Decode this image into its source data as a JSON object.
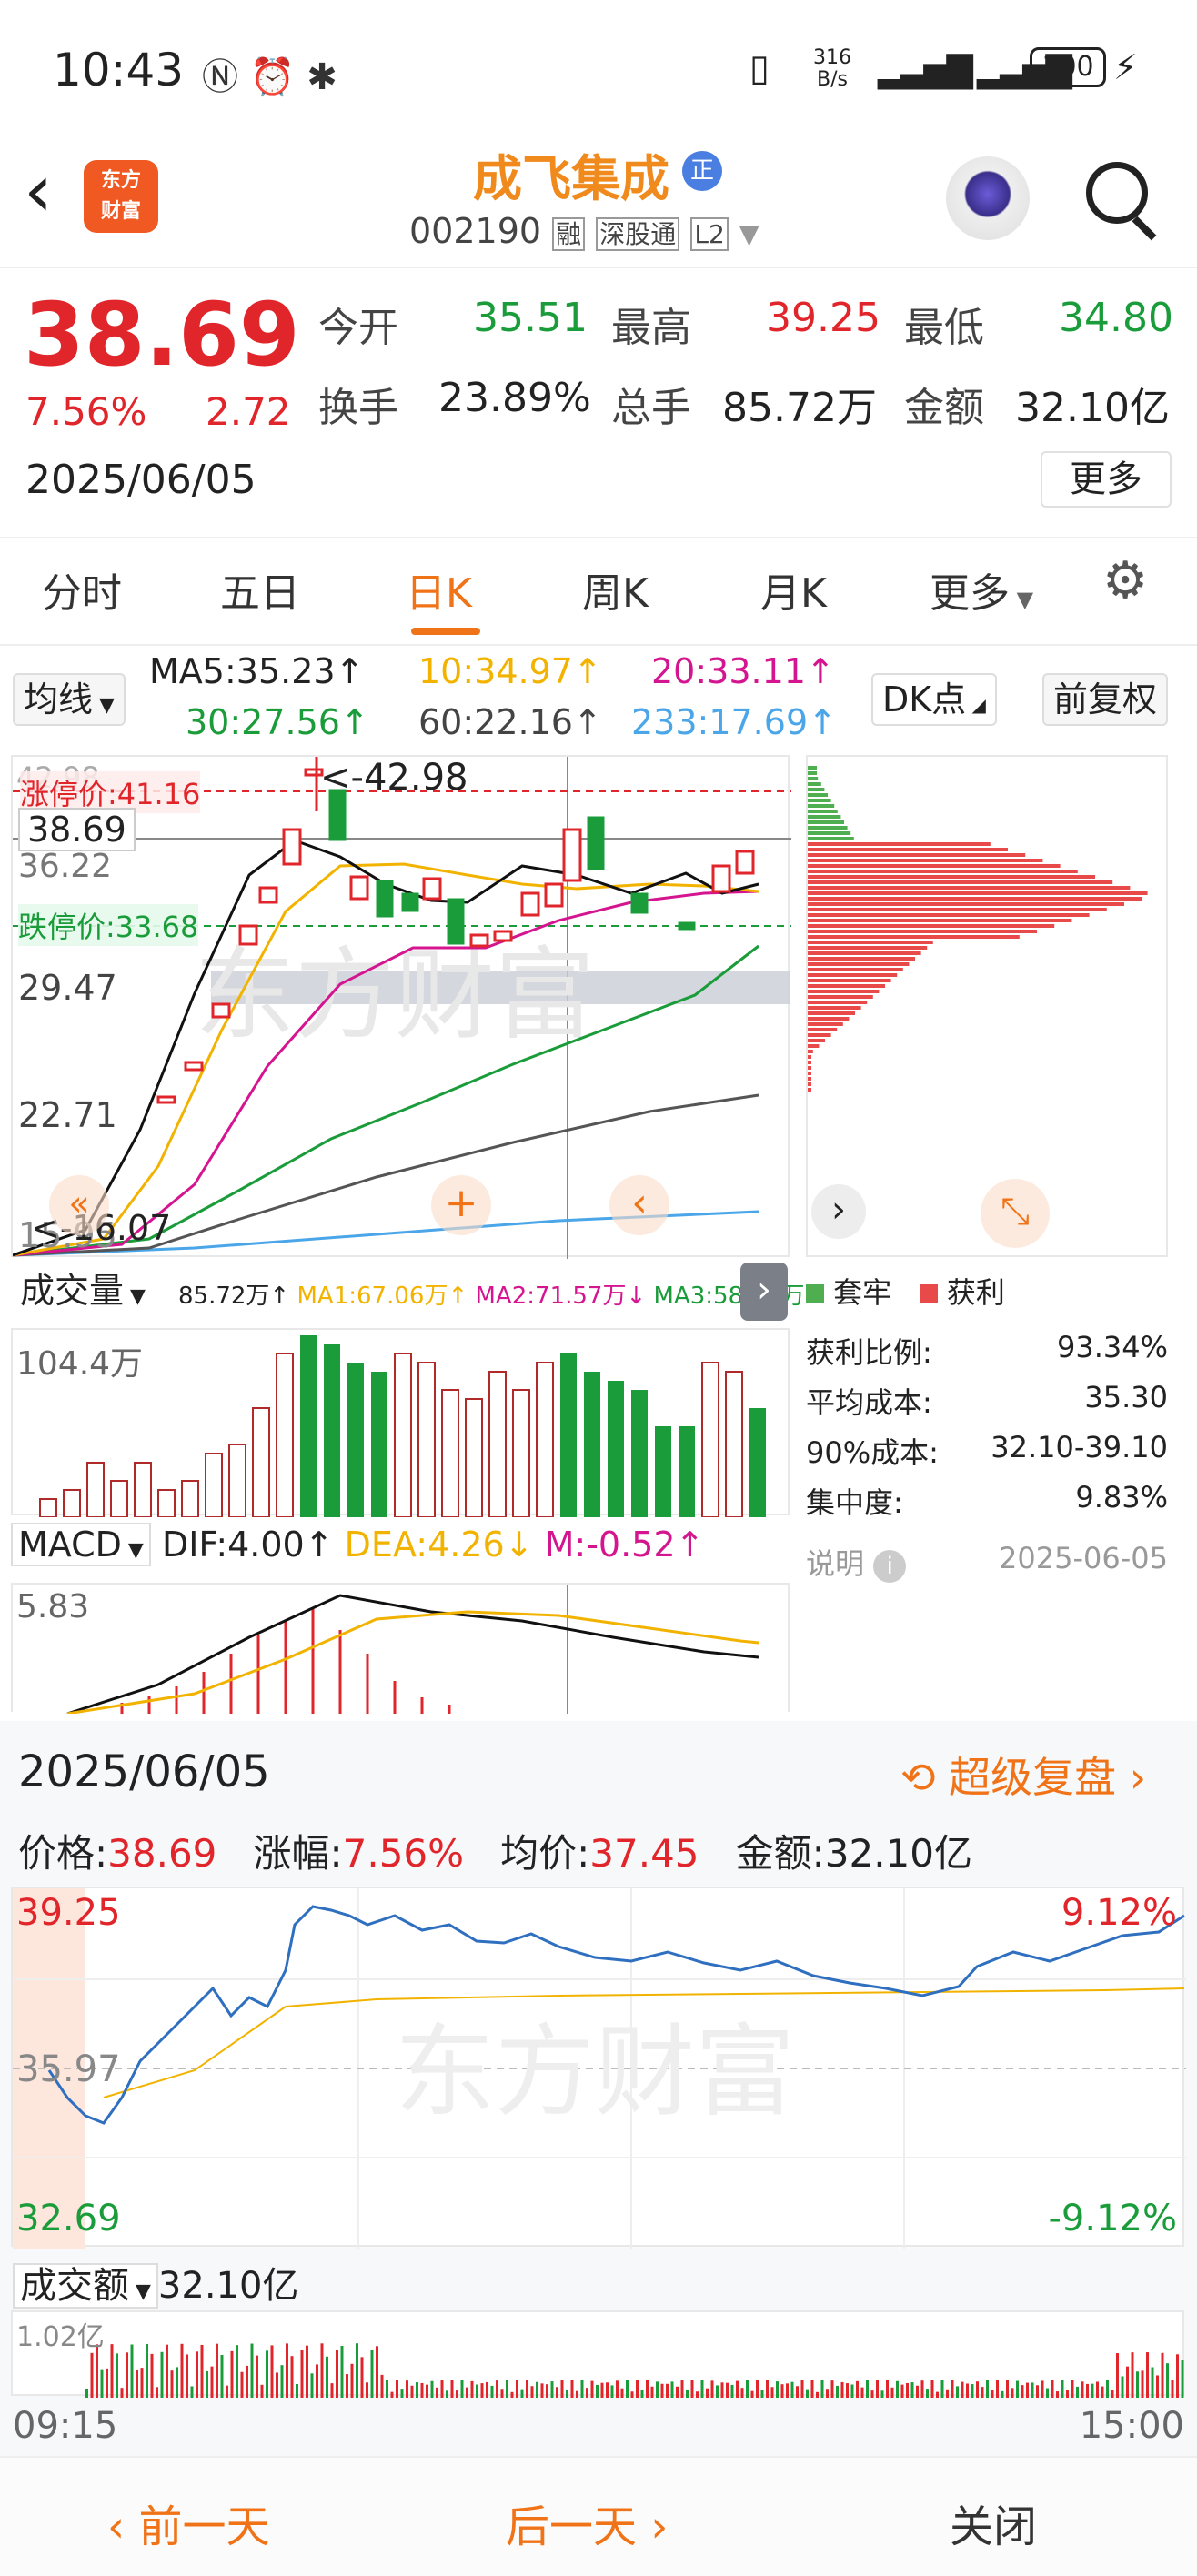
{
  "status": {
    "time": "10:43",
    "net": "316",
    "net_unit": "B/s",
    "battery": "100"
  },
  "header": {
    "stock_name": "成飞集成",
    "badge": "正",
    "code": "002190",
    "tags": [
      "融",
      "深股通",
      "L2"
    ],
    "logo_line1": "东方",
    "logo_line2": "财富"
  },
  "quote": {
    "price": "38.69",
    "pct": "7.56%",
    "change": "2.72",
    "date": "2025/06/05",
    "more": "更多",
    "stats": [
      {
        "label": "今开",
        "value": "35.51"
      },
      {
        "label": "最高",
        "value": "39.25"
      },
      {
        "label": "最低",
        "value": "34.80"
      },
      {
        "label": "换手",
        "value": "23.89%"
      },
      {
        "label": "总手",
        "value": "85.72万"
      },
      {
        "label": "金额",
        "value": "32.10亿"
      }
    ]
  },
  "tabs": [
    "分时",
    "五日",
    "日K",
    "周K",
    "月K",
    "更多"
  ],
  "kchart": {
    "ma_select": "均线",
    "dk": "DK点",
    "fq": "前复权",
    "ma": [
      {
        "t": "MA5:35.23↑",
        "c": "#222"
      },
      {
        "t": "10:34.97↑",
        "c": "#f2b300"
      },
      {
        "t": "20:33.11↑",
        "c": "#d4158f"
      },
      {
        "t": "30:27.56↑",
        "c": "#1a9c3a"
      },
      {
        "t": "60:22.16↑",
        "c": "#444"
      },
      {
        "t": "233:17.69↑",
        "c": "#4aa6e8"
      }
    ],
    "yticks": [
      "42.98",
      "36.22",
      "29.47",
      "22.71",
      "15.95"
    ],
    "limit_up": "涨停价:41.16",
    "limit_down": "跌停价:33.68",
    "cur": "38.69",
    "hi_note": "<-42.98",
    "lo_note": "<-16.07"
  },
  "vol": {
    "select": "成交量",
    "v": "85.72万↑",
    "ma1": "MA1:67.06万↑",
    "ma2": "MA2:71.57万↓",
    "ma3": "MA3:58.24万↑",
    "ymax": "104.4万"
  },
  "macd": {
    "select": "MACD",
    "dif": "DIF:4.00↑",
    "dea": "DEA:4.26↓",
    "m": "M:-0.52↑",
    "ymax": "5.83"
  },
  "chip": {
    "legend1": "套牢",
    "legend2": "获利",
    "rows": [
      {
        "k": "获利比例:",
        "v": "93.34%"
      },
      {
        "k": "平均成本:",
        "v": "35.30"
      },
      {
        "k": "90%成本:",
        "v": "32.10-39.10"
      },
      {
        "k": "集中度:",
        "v": "9.83%"
      }
    ],
    "note": "说明",
    "note_date": "2025-06-05"
  },
  "intraday": {
    "date": "2025/06/05",
    "replay": "超级复盘",
    "price_lbl": "价格:",
    "price": "38.69",
    "pct_lbl": "涨幅:",
    "pct": "7.56%",
    "avg_lbl": "均价:",
    "avg": "37.45",
    "amt_lbl": "金额:",
    "amt": "32.10亿",
    "y_top": "39.25",
    "y_mid": "35.97",
    "y_bot": "32.69",
    "p_top": "9.12%",
    "p_bot": "-9.12%",
    "vol_select": "成交额",
    "vol_val": "32.10亿",
    "vol_max": "1.02亿",
    "t_start": "09:15",
    "t_end": "15:00",
    "watermark": "东方财富"
  },
  "footer": {
    "prev": "前一天",
    "next": "后一天",
    "close": "关闭"
  }
}
